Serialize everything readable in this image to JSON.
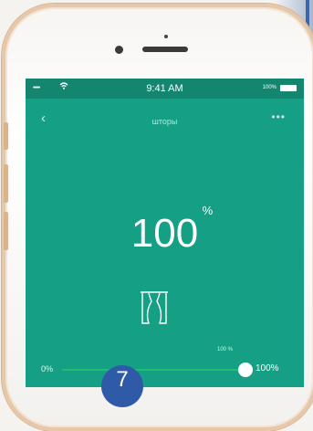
{
  "status_bar": {
    "signal": "•••••",
    "time": "9:41 AM",
    "battery_text": "100%"
  },
  "nav": {
    "back_icon": "‹",
    "title": "шторы",
    "more_icon": "•••"
  },
  "control": {
    "value": "100",
    "unit": "%"
  },
  "slider": {
    "top_label": "100 %",
    "min_label": "0%",
    "max_label": "100%",
    "level": 1.0
  },
  "badge": {
    "number": "7"
  },
  "colors": {
    "screen": "#159f84",
    "status": "#14856f",
    "accent_track": "#1ec06f",
    "badge": "#2f5aa7"
  },
  "icons": {
    "curtain": "curtain-icon",
    "wifi": "wifi-icon",
    "battery": "battery-icon"
  }
}
